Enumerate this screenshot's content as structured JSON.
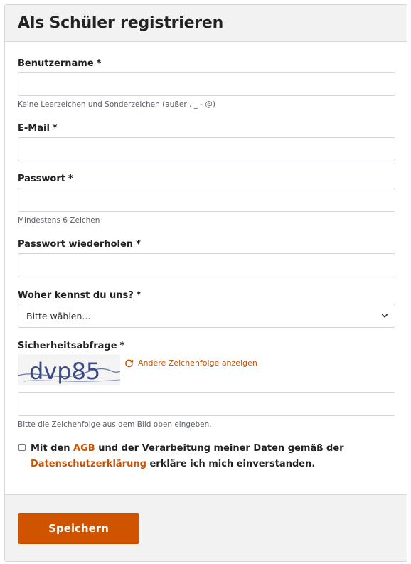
{
  "form": {
    "title": "Als Schüler registrieren",
    "required_marker": "*",
    "username": {
      "label": "Benutzername",
      "value": "",
      "hint": "Keine Leerzeichen und Sonderzeichen (außer . _ - @)"
    },
    "email": {
      "label": "E-Mail",
      "value": ""
    },
    "password": {
      "label": "Passwort",
      "value": "",
      "hint": "Mindestens 6 Zeichen"
    },
    "password_repeat": {
      "label": "Passwort wiederholen",
      "value": ""
    },
    "referral": {
      "label": "Woher kennst du uns?",
      "selected": "Bitte wählen..."
    },
    "captcha": {
      "label": "Sicherheitsabfrage",
      "image_text": "dvp85",
      "refresh_label": "Andere Zeichenfolge anzeigen",
      "value": "",
      "hint": "Bitte die Zeichenfolge aus dem Bild oben eingeben."
    },
    "consent": {
      "checked": false,
      "text_1": "Mit den ",
      "agb_link": "AGB",
      "text_2": " und der Verarbeitung meiner Daten gemäß der ",
      "privacy_link": "Datenschutzerklärung",
      "text_3": " erkläre ich mich einverstanden."
    },
    "save_label": "Speichern"
  },
  "colors": {
    "accent": "#d05400",
    "link": "#c85000",
    "header_bg": "#f2f2f2",
    "border": "#d7d7d7"
  },
  "icons": {
    "refresh": "refresh-icon",
    "select_chevron": "chevron-down-icon"
  }
}
